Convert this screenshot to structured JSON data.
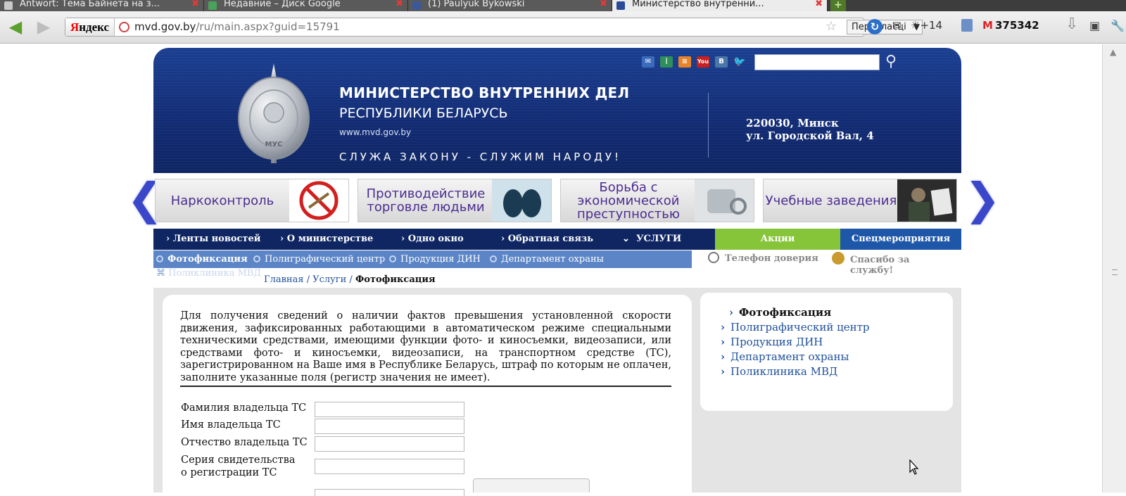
{
  "browser": {
    "tabs": [
      {
        "title": "Antwort: Тема Байнета на з...",
        "favicon_color": "#c9c9c9"
      },
      {
        "title": "Недавние – Диск Google",
        "favicon_color": "#4aa35a"
      },
      {
        "title": "(1) Paulyuk Bykowski",
        "favicon_color": "#3b5998"
      },
      {
        "title": "Министерство внутренни...",
        "favicon_color": "#2a4a9a"
      }
    ],
    "tab_close": "✖",
    "new_tab": "+",
    "back_icon": "back-arrow-icon",
    "forward_icon": "forward-arrow-icon",
    "search_brand_first": "Я",
    "search_brand_rest": "ндекс",
    "url_host": "mvd.gov.by",
    "url_path": "/ru/main.aspx?guid=15791",
    "translate_label": "Перакласці",
    "weather": "☀+14",
    "mail_count": "375342",
    "accent_green": "#86c43a",
    "accent_blue": "#0f2663"
  },
  "site": {
    "ministry_line1": "МИНИСТЕРСТВО ВНУТРЕННИХ ДЕЛ",
    "ministry_line2": "РЕСПУБЛИКИ БЕЛАРУСЬ",
    "site_url": "www.mvd.gov.by",
    "slogan": "СЛУЖА ЗАКОНУ - СЛУЖИМ НАРОДУ!",
    "address_line1": "220030, Минск",
    "address_line2": "ул. Городской Вал, 4",
    "emblem_text": "МУС",
    "social_icons": [
      "mail-icon",
      "share-icon",
      "rss-icon",
      "youtube-icon",
      "vkontakte-icon",
      "twitter-icon"
    ],
    "social_vk": "B",
    "social_yt": "You"
  },
  "banners": [
    {
      "label": "Наркоконтроль"
    },
    {
      "label": "Противодействие торговле людьми"
    },
    {
      "label": "Борьба с экономической преступностью"
    },
    {
      "label": "Учебные заведения"
    }
  ],
  "banner_prev": "❮",
  "banner_next": "❯",
  "nav": {
    "items": [
      "Ленты новостей",
      "О министерстве",
      "Одно окно",
      "Обратная связь",
      "УСЛУГИ"
    ],
    "akcii": "Акции",
    "spec": "Спецмероприятия"
  },
  "subnav": {
    "items": [
      "Фотофиксация",
      "Полиграфический центр",
      "Продукция ДИН",
      "Департамент охраны"
    ],
    "second_row": "Поликлиника МВД"
  },
  "helpers": {
    "trust_phone": "Телефон доверия",
    "thanks_line1": "Спасибо за",
    "thanks_line2": "службу!"
  },
  "breadcrumbs": {
    "home": "Главная",
    "sep": " / ",
    "services": "Услуги",
    "current": "Фотофиксация"
  },
  "form": {
    "intro": "Для получения сведений о наличии фактов превышения установленной скорости движения, зафиксированных работающими в автоматическом режиме специальными техническими средствами, имеющими функции фото- и киносъемки, видеозаписи, или средствами фото- и киносъемки, видеозаписи, на транспортном средстве (ТС), зарегистрированном на Ваше имя в Республике Беларусь, штраф по которым не оплачен, заполните указанные поля (регистр значения не имеет).",
    "fields": [
      {
        "label": "Фамилия владельца ТС",
        "value": ""
      },
      {
        "label": "Имя владельца ТС",
        "value": ""
      },
      {
        "label": "Отчество владельца ТС",
        "value": ""
      },
      {
        "label_line1": "Серия свидетельства",
        "label_line2": "о регистрации ТС",
        "value": ""
      }
    ]
  },
  "sidebar": {
    "items": [
      "Фотофиксация",
      "Полиграфический центр",
      "Продукция ДИН",
      "Департамент охраны",
      "Поликлиника МВД"
    ]
  }
}
